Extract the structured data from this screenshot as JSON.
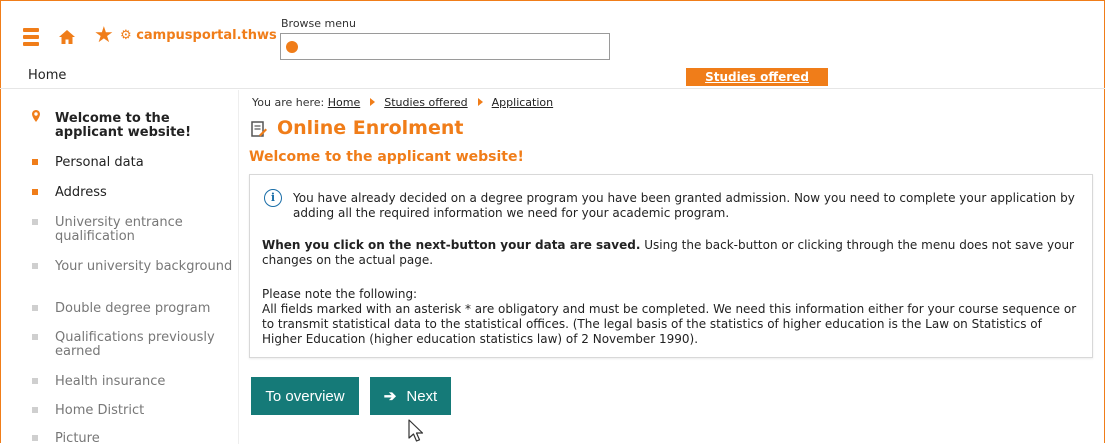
{
  "header": {
    "brand": "campusportal.thws",
    "browse_label": "Browse menu",
    "nav_home": "Home",
    "studies_tab": "Studies offered",
    "icons": [
      "menu-icon",
      "home-icon",
      "star-icon",
      "search-icon"
    ],
    "accent": "#f07d19"
  },
  "sidebar": {
    "items": [
      {
        "label": "Welcome to the applicant website!",
        "state": "current"
      },
      {
        "label": "Personal data",
        "state": "done"
      },
      {
        "label": "Address",
        "state": "done"
      },
      {
        "label": "University entrance qualification",
        "state": "pending"
      },
      {
        "label": "Your university background",
        "state": "pending"
      },
      {
        "label": "Double degree program",
        "state": "pending"
      },
      {
        "label": "Qualifications previously earned",
        "state": "pending"
      },
      {
        "label": "Health insurance",
        "state": "pending"
      },
      {
        "label": "Home District",
        "state": "pending"
      },
      {
        "label": "Picture",
        "state": "pending"
      }
    ]
  },
  "breadcrumb": {
    "prefix": "You are here:",
    "items": [
      "Home",
      "Studies offered",
      "Application"
    ]
  },
  "main": {
    "title": "Online Enrolment",
    "subtitle": "Welcome to the applicant website!",
    "info": {
      "p1": "You have already decided on a degree program you have been granted admission. Now you need to complete your application by adding all the required information we need for your academic program.",
      "p2_bold": "When you click on the next-button your data are saved.",
      "p2_rest": " Using the back-button or clicking through the menu does not save your changes on the actual page.",
      "p3": "Please note the following:",
      "p4": "All fields marked with an asterisk * are obligatory and must be completed. We need this information either for your course sequence or to transmit statistical data to the statistical offices. (The legal basis of the statistics of higher education is the Law on Statistics of Higher Education (higher education statistics law) of 2 November 1990)."
    },
    "buttons": {
      "overview": "To overview",
      "next": "Next"
    },
    "button_color": "#157a78"
  }
}
